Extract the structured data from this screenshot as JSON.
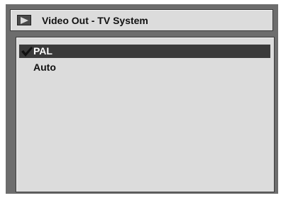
{
  "title_bar": {
    "icon": "play-arrow-icon",
    "title": "Video Out - TV System"
  },
  "menu": {
    "items": [
      {
        "label": "PAL",
        "selected": true,
        "checked": true
      },
      {
        "label": "Auto",
        "selected": false,
        "checked": false
      }
    ]
  },
  "colors": {
    "screen_bg": "#6d6d6d",
    "panel_bg": "#dcdcdc",
    "highlight": "#3a3a3a",
    "text": "#111111"
  }
}
